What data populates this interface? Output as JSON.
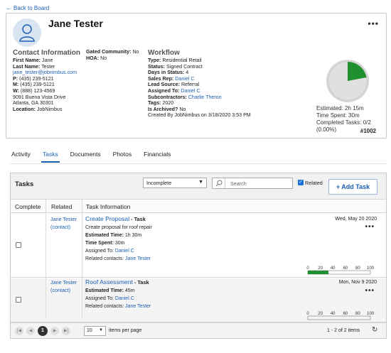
{
  "nav": {
    "back_label": "Back to Board"
  },
  "contact": {
    "name": "Jane Tester",
    "contact_info": {
      "heading": "Contact Information",
      "first_name_label": "First Name:",
      "first_name": "Jane",
      "last_name_label": "Last Name:",
      "last_name": "Tester",
      "email": "jane_tester@jobnimbus.com",
      "phone_p_label": "P:",
      "phone_p": "(435) 239-5121",
      "phone_m_label": "M:",
      "phone_m": "(435) 239-5121",
      "phone_w_label": "W:",
      "phone_w": "(888) 123-4569",
      "address1": "9091 Buena Vista Drive",
      "address2": "Atlanta, GA 30301",
      "location_label": "Location:",
      "location": "JobNimbus"
    },
    "community": {
      "gated_label": "Gated Community:",
      "gated": "No",
      "hoa_label": "HOA:",
      "hoa": "No"
    },
    "workflow": {
      "heading": "Workflow",
      "type_label": "Type:",
      "type": "Residential Retail",
      "status_label": "Status:",
      "status": "Signed Contract",
      "days_label": "Days in Status:",
      "days": "4",
      "sales_rep_label": "Sales Rep:",
      "sales_rep": "Daniel C",
      "lead_source_label": "Lead Source:",
      "lead_source": "Referral",
      "assigned_label": "Assigned To:",
      "assigned": "Daniel C",
      "subs_label": "Subcontractors:",
      "subs": "Charlie Theron",
      "tags_label": "Tags:",
      "tags": "2020",
      "archived_label": "Is Archived?",
      "archived": "No",
      "created": "Created By JobNimbus on 3/18/2020 3:53 PM"
    },
    "stats": {
      "estimated": "Estimated: 2h 15m",
      "time_spent": "Time Spent: 30m",
      "completed": "Completed Tasks: 0/2",
      "completed_pct": "(0.00%)",
      "pie_fraction": 0.22,
      "pie_color": "#1f8f2f"
    },
    "job_number": "#1002"
  },
  "tabs": [
    {
      "label": "Activity"
    },
    {
      "label": "Tasks"
    },
    {
      "label": "Documents"
    },
    {
      "label": "Photos"
    },
    {
      "label": "Financials"
    }
  ],
  "tasks_panel": {
    "title": "Tasks",
    "filter_value": "Incomplete",
    "search_placeholder": "Search",
    "related_label": "Related",
    "add_label": "+ Add Task",
    "columns": {
      "complete": "Complete",
      "related": "Related",
      "info": "Task Information"
    },
    "rows": [
      {
        "related_name": "Jane Tester",
        "related_type": "(contact)",
        "title": "Create Proposal",
        "type": "- Task",
        "description": "Create proposal for roof repair",
        "est_label": "Estimated Time:",
        "est": "1h 30m",
        "spent_label": "Time Spent:",
        "spent": "30m",
        "assigned_label": "Assigned To:",
        "assigned": "Daniel C",
        "related_contacts_label": "Related contacts:",
        "related_contacts": "Jane Tester",
        "date": "Wed, May 20 2020",
        "gauge_value": 33
      },
      {
        "related_name": "Jane Tester",
        "related_type": "(contact)",
        "title": "Roof Assessment",
        "type": "- Task",
        "est_label": "Estimated Time:",
        "est": "45m",
        "assigned_label": "Assigned To:",
        "assigned": "Daniel C",
        "related_contacts_label": "Related contacts:",
        "related_contacts": "Jane Tester",
        "date": "Mon, Nov 9 2020",
        "gauge_value": 0
      }
    ],
    "gauge_ticks": [
      "0",
      "20",
      "40",
      "60",
      "80",
      "100"
    ],
    "pagination": {
      "current": "1",
      "per_page": "10",
      "per_page_label": "items per page",
      "count": "1 - 2 of 2 items"
    }
  }
}
